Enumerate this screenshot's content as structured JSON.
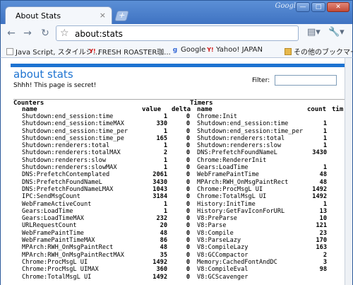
{
  "browser": {
    "tab_title": "About Stats",
    "tab_close": "×",
    "new_tab": "+",
    "google_logo": "Google",
    "url": "about:stats",
    "controls": {
      "minimize": "—",
      "maximize": "□",
      "close": "✕"
    },
    "toolbar_icons": {
      "back": "←",
      "forward": "→",
      "reload": "↻",
      "star": "☆",
      "page": "▤▾",
      "wrench": "🔧▾"
    }
  },
  "bookmarks": {
    "items": [
      {
        "label": "Java Script, スタイルシ...",
        "icon": "page-icon"
      },
      {
        "label": "FRESH ROASTER珈...",
        "icon": "yahoo-icon"
      },
      {
        "label": "Google",
        "icon": "google-icon"
      },
      {
        "label": "Yahoo! JAPAN",
        "icon": "yahoo-icon"
      }
    ],
    "other": "その他のブックマーク"
  },
  "page": {
    "title": "about stats",
    "subtitle": "Shhh! This page is secret!",
    "filter_label": "Filter:",
    "filter_value": "",
    "accent_color": "#1d73d1"
  },
  "table": {
    "counters_heading": "Counters",
    "timers_heading": "Timers",
    "col_name": "name",
    "col_value": "value",
    "col_delta": "delta",
    "col_tname": "name",
    "col_count": "count",
    "col_time": "tim",
    "rows": [
      {
        "cname": "Shutdown:end_session:time",
        "value": "1",
        "delta": "0",
        "tname": "Chrome:Init",
        "count": ""
      },
      {
        "cname": "Shutdown:end_session:timeMAX",
        "value": "330",
        "delta": "0",
        "tname": "Shutdown:end_session:time",
        "count": "1"
      },
      {
        "cname": "Shutdown:end_session:time_per",
        "value": "1",
        "delta": "0",
        "tname": "Shutdown:end_session:time_per",
        "count": "1"
      },
      {
        "cname": "Shutdown:end_session:time_pe",
        "value": "165",
        "delta": "0",
        "tname": "Shutdown:renderers:total",
        "count": "1"
      },
      {
        "cname": "Shutdown:renderers:total",
        "value": "1",
        "delta": "0",
        "tname": "Shutdown:renderers:slow",
        "count": "1"
      },
      {
        "cname": "Shutdown:renderers:totalMAX",
        "value": "2",
        "delta": "0",
        "tname": "DNS:PrefetchFoundNameL",
        "count": "3430"
      },
      {
        "cname": "Shutdown:renderers:slow",
        "value": "1",
        "delta": "0",
        "tname": "Chrome:RendererInit",
        "count": ""
      },
      {
        "cname": "Shutdown:renderers:slowMAX",
        "value": "1",
        "delta": "0",
        "tname": "Gears:LoadTime",
        "count": "1"
      },
      {
        "cname": "DNS:PrefetchContemplated",
        "value": "2061",
        "delta": "0",
        "tname": "WebFramePaintTime",
        "count": "48"
      },
      {
        "cname": "DNS:PrefetchFoundNameL",
        "value": "3430",
        "delta": "0",
        "tname": "MPArch:RWH_OnMsgPaintRect",
        "count": "48"
      },
      {
        "cname": "DNS:PrefetchFoundNameLMAX",
        "value": "1043",
        "delta": "0",
        "tname": "Chrome:ProcMsgL UI",
        "count": "1492"
      },
      {
        "cname": "IPC:SendMsgCount",
        "value": "3184",
        "delta": "0",
        "tname": "Chrome:TotalMsgL UI",
        "count": "1492"
      },
      {
        "cname": "WebFrameActiveCount",
        "value": "1",
        "delta": "0",
        "tname": "History:InitTime",
        "count": "1"
      },
      {
        "cname": "Gears:LoadTime",
        "value": "1",
        "delta": "0",
        "tname": "History:GetFavIconForURL",
        "count": "13"
      },
      {
        "cname": "Gears:LoadTimeMAX",
        "value": "232",
        "delta": "0",
        "tname": "V8:PreParse",
        "count": "10"
      },
      {
        "cname": "URLRequestCount",
        "value": "20",
        "delta": "0",
        "tname": "V8:Parse",
        "count": "121"
      },
      {
        "cname": "WebFramePaintTime",
        "value": "48",
        "delta": "0",
        "tname": "V8:Compile",
        "count": "23"
      },
      {
        "cname": "WebFramePaintTimeMAX",
        "value": "86",
        "delta": "0",
        "tname": "V8:ParseLazy",
        "count": "170"
      },
      {
        "cname": "MPArch:RWH_OnMsgPaintRect",
        "value": "48",
        "delta": "0",
        "tname": "V8:CompileLazy",
        "count": "163"
      },
      {
        "cname": "MPArch:RWH_OnMsgPaintRectMAX",
        "value": "35",
        "delta": "0",
        "tname": "V8:GCCompactor",
        "count": "2"
      },
      {
        "cname": "Chrome:ProcMsgL UI",
        "value": "1492",
        "delta": "0",
        "tname": "Memory:CachedFontAndDC",
        "count": "3"
      },
      {
        "cname": "Chrome:ProcMsgL UIMAX",
        "value": "360",
        "delta": "0",
        "tname": "V8:CompileEval",
        "count": "98"
      },
      {
        "cname": "Chrome:TotalMsgL UI",
        "value": "1492",
        "delta": "0",
        "tname": "V8:GCScavenger",
        "count": ""
      }
    ]
  }
}
